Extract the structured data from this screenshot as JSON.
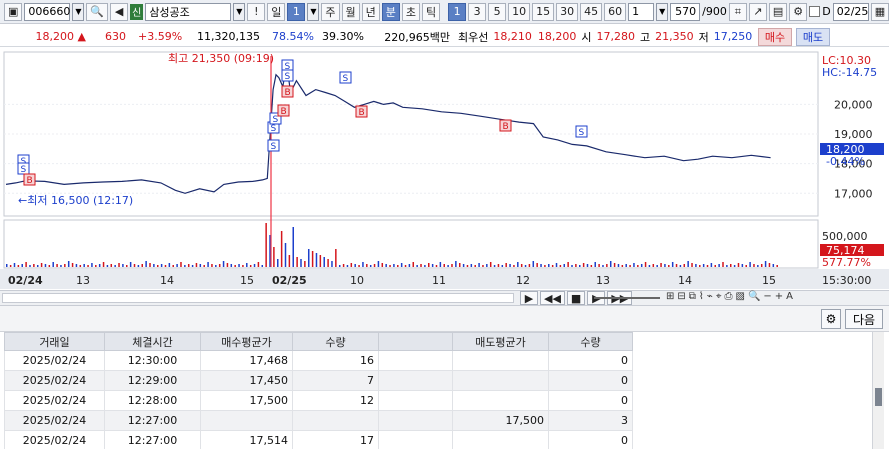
{
  "toolbar": {
    "stock_code": "006660",
    "credit_badge": "신",
    "stock_name": "삼성공조",
    "alert": "!",
    "period_day": "일",
    "period_num": "1",
    "period_buttons": [
      "주",
      "월",
      "년",
      "분",
      "초",
      "틱"
    ],
    "minute_buttons": [
      "1",
      "3",
      "5",
      "10",
      "15",
      "30",
      "45",
      "60"
    ],
    "interval_value": "1",
    "count_value": "570",
    "count_total": "/900",
    "date_value": "02/25",
    "checkbox_label": "D"
  },
  "quote": {
    "price": "18,200",
    "change": "630",
    "change_pct": "+3.59%",
    "volume": "11,320,135",
    "vol_ratio": "78.54%",
    "turnover": "39.30%",
    "amount": "220,965백만",
    "best_ask_label": "최우선",
    "best_ask": "18,210",
    "best_bid": "18,200",
    "open_label": "시",
    "open": "17,280",
    "high_label": "고",
    "high": "21,350",
    "low_label": "저",
    "low": "17,250",
    "buy_label": "매수",
    "sell_label": "매도"
  },
  "chart_labels": {
    "high_note": "최고 21,350 (09:19)",
    "low_note": "←최저 16,500 (12:17)",
    "lc": "LC:10.30",
    "hc": "HC:-14.75",
    "price_tag": "18,200",
    "pct_tag": "-0.44%",
    "vol_tag": "75,174",
    "vol_pct_tag": "577.77%",
    "end_time": "15:30:00",
    "buy_marker": "B",
    "sell_marker": "S"
  },
  "chart_data": {
    "type": "line",
    "y_ticks": [
      20000,
      19000,
      18000,
      17000
    ],
    "ylim": [
      16300,
      21700
    ],
    "volume_ticks": [
      "500,000"
    ],
    "x_labels": [
      "02/24",
      "13",
      "14",
      "15",
      "02/25",
      "10",
      "11",
      "12",
      "13",
      "14",
      "15"
    ],
    "price_points": [
      [
        0,
        17300
      ],
      [
        10,
        17350
      ],
      [
        20,
        17420
      ],
      [
        40,
        17400
      ],
      [
        60,
        17300
      ],
      [
        80,
        17350
      ],
      [
        100,
        17380
      ],
      [
        120,
        17400
      ],
      [
        140,
        17450
      ],
      [
        160,
        17350
      ],
      [
        175,
        17100
      ],
      [
        185,
        17000
      ],
      [
        200,
        17150
      ],
      [
        215,
        17050
      ],
      [
        225,
        17300
      ],
      [
        240,
        17380
      ],
      [
        255,
        17400
      ],
      [
        265,
        17450
      ],
      [
        270,
        17500
      ],
      [
        273,
        19000
      ],
      [
        276,
        20500
      ],
      [
        279,
        21000
      ],
      [
        282,
        20900
      ],
      [
        286,
        20600
      ],
      [
        290,
        21350
      ],
      [
        294,
        20400
      ],
      [
        300,
        20800
      ],
      [
        310,
        20300
      ],
      [
        320,
        20500
      ],
      [
        330,
        20400
      ],
      [
        340,
        20300
      ],
      [
        350,
        20100
      ],
      [
        360,
        19900
      ],
      [
        370,
        20000
      ],
      [
        380,
        20100
      ],
      [
        390,
        20000
      ],
      [
        400,
        20050
      ],
      [
        410,
        19900
      ],
      [
        430,
        19850
      ],
      [
        450,
        19750
      ],
      [
        470,
        19700
      ],
      [
        490,
        19600
      ],
      [
        510,
        19500
      ],
      [
        530,
        19400
      ],
      [
        545,
        19350
      ],
      [
        555,
        18900
      ],
      [
        570,
        18800
      ],
      [
        585,
        18650
      ],
      [
        600,
        18600
      ],
      [
        620,
        18400
      ],
      [
        640,
        18300
      ],
      [
        660,
        18200
      ],
      [
        680,
        18250
      ],
      [
        700,
        18100
      ],
      [
        715,
        18150
      ],
      [
        730,
        18250
      ],
      [
        750,
        18200
      ],
      [
        770,
        18280
      ],
      [
        790,
        18200
      ]
    ],
    "volume_ticks_values": [
      0,
      500000
    ]
  },
  "table": {
    "headers": [
      "거래일",
      "체결시간",
      "매수평균가",
      "수량",
      "",
      "매도평균가",
      "수량"
    ],
    "rows": [
      [
        "2025/02/24",
        "12:30:00",
        "17,468",
        "16",
        "",
        "",
        "0"
      ],
      [
        "2025/02/24",
        "12:29:00",
        "17,450",
        "7",
        "",
        "",
        "0"
      ],
      [
        "2025/02/24",
        "12:28:00",
        "17,500",
        "12",
        "",
        "",
        "0"
      ],
      [
        "2025/02/24",
        "12:27:00",
        "",
        "",
        "",
        "17,500",
        "3"
      ],
      [
        "2025/02/24",
        "12:27:00",
        "17,514",
        "17",
        "",
        "",
        "0"
      ]
    ],
    "next_label": "다음"
  }
}
